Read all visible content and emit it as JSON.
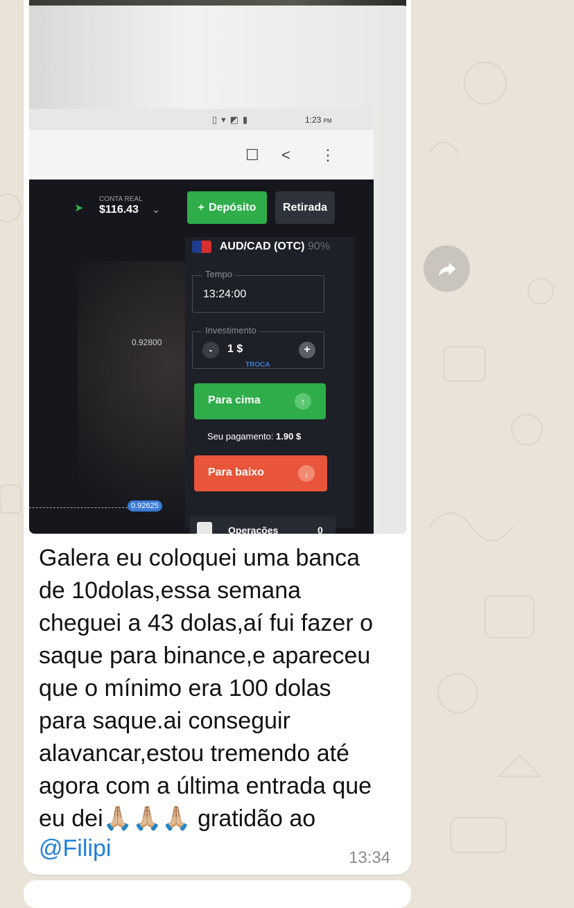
{
  "screen_in_photo": {
    "status_time": "1:23",
    "status_ampm": "PM",
    "account_label": "CONTA REAL",
    "balance": "$116.43",
    "deposit_label": "Depósito",
    "withdraw_label": "Retirada",
    "asset": "AUD/CAD (OTC)",
    "asset_payout_pct": "90%",
    "time_label": "Tempo",
    "time_value": "13:24:00",
    "investment_label": "Investimento",
    "investment_value": "1 $",
    "swap_label": "TROCA",
    "up_label": "Para cima",
    "payout_label": "Seu pagamento:",
    "payout_value": "1.90 $",
    "down_label": "Para baixo",
    "price_level_1": "0.92800",
    "price_level_2": "0.92625",
    "operations_label": "Operações",
    "operations_count": "0"
  },
  "message": {
    "caption_lines": [
      "Galera eu coloquei uma banca",
      "de 10dolas,essa semana",
      "cheguei a 43 dolas,aí fui fazer o",
      "saque para binance,e apareceu",
      "que o mínimo era 100 dolas",
      "para saque.ai conseguir",
      "alavancar,estou tremendo até",
      "agora com a última entrada que",
      "eu dei🙏🏼🙏🏼🙏🏼 gratidão ao"
    ],
    "mention": "@Filipi",
    "timestamp": "13:34"
  },
  "colors": {
    "chat_background": "#e9e3d8",
    "bubble": "#ffffff",
    "mention_link": "#1e7fd8",
    "up_green": "#2fad4a",
    "down_orange": "#e8553a"
  },
  "icons": [
    "paper-plane-icon",
    "bookmark-icon",
    "share-icon",
    "more-vert-icon",
    "forward-icon",
    "arrow-up-icon",
    "arrow-down-icon",
    "plus-icon",
    "minus-icon"
  ]
}
